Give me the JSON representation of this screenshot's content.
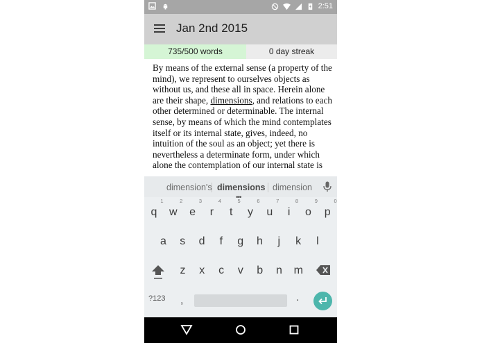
{
  "status_bar": {
    "time": "2:51"
  },
  "app_bar": {
    "title": "Jan 2nd 2015"
  },
  "stats": {
    "words": "735/500 words",
    "streak": "0 day streak"
  },
  "editor": {
    "text_before": "By means of the external sense (a property of the mind), we represent to ourselves objects as without us, and these all in space. Herein alone are their shape, ",
    "underlined_word": "dimensions",
    "text_after": ", and relations to each other determined or determinable. The internal sense, by means of which the mind contemplates itself or its internal state, gives, indeed, no intuition of the soul as an object; yet there is nevertheless a determinate form, under which alone the contemplation of our internal state is"
  },
  "keyboard": {
    "suggestions": [
      "dimension's",
      "dimensions",
      "dimension"
    ],
    "row1": [
      {
        "k": "q",
        "h": "1"
      },
      {
        "k": "w",
        "h": "2"
      },
      {
        "k": "e",
        "h": "3"
      },
      {
        "k": "r",
        "h": "4"
      },
      {
        "k": "t",
        "h": "5"
      },
      {
        "k": "y",
        "h": "6"
      },
      {
        "k": "u",
        "h": "7"
      },
      {
        "k": "i",
        "h": "8"
      },
      {
        "k": "o",
        "h": "9"
      },
      {
        "k": "p",
        "h": "0"
      }
    ],
    "row2": [
      "a",
      "s",
      "d",
      "f",
      "g",
      "h",
      "j",
      "k",
      "l"
    ],
    "row3": [
      "z",
      "x",
      "c",
      "v",
      "b",
      "n",
      "m"
    ],
    "symbols_label": "?123",
    "comma": ",",
    "period": ".",
    "accent_color": "#4db6ac"
  },
  "colors": {
    "words_bg": "#d5f5d5",
    "streak_bg": "#ececec",
    "status_bar": "#a6a6a6",
    "app_bar": "#d0d0d0"
  }
}
